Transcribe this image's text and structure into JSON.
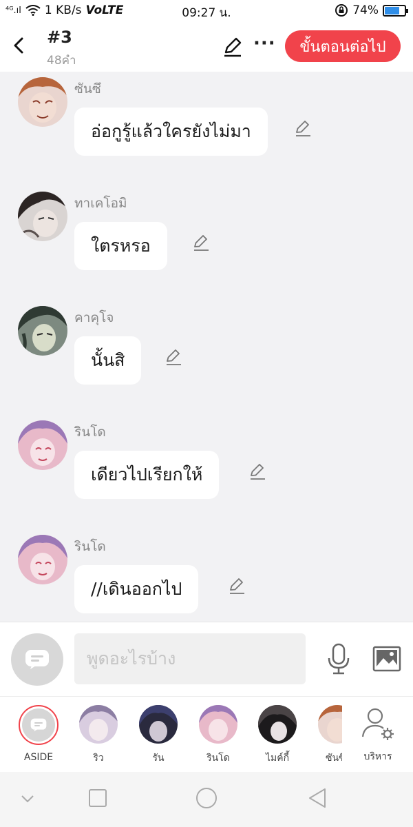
{
  "status_bar": {
    "signal": "⁴ᴳ.ıl",
    "speed": "1 KB/s",
    "network": "VoLTE",
    "time": "09:27 น.",
    "battery": "74%",
    "battery_level": 0.74,
    "battery_color": "#2f8ee8"
  },
  "header": {
    "title": "#3",
    "subtitle": "48คำ",
    "more_label": "···",
    "next_button": "ขั้นตอนต่อไป",
    "accent": "#f1434b"
  },
  "messages": [
    {
      "speaker": "ซันซึ",
      "text": "อ่อกูรู้แล้วใครยังไม่มา"
    },
    {
      "speaker": "ทาเคโอมิ",
      "text": "ใตรหรอ"
    },
    {
      "speaker": "คาคุโจ",
      "text": "นั้นสิ"
    },
    {
      "speaker": "รินโด",
      "text": "เดียวไปเรียกให้"
    },
    {
      "speaker": "รินโด",
      "text": "//เดินออกไป"
    }
  ],
  "composer": {
    "placeholder": "พูดอะไรบ้าง"
  },
  "characters": [
    {
      "name": "ASIDE"
    },
    {
      "name": "ริว"
    },
    {
      "name": "รัน"
    },
    {
      "name": "รินโด"
    },
    {
      "name": "ไมค์กี้"
    },
    {
      "name": "ซันซึ"
    },
    {
      "name": "บริหาร"
    }
  ],
  "icons": {
    "back": "chevron-left-icon",
    "edit": "pencil-icon",
    "mic": "microphone-icon",
    "image": "image-icon",
    "settings": "user-settings-icon"
  }
}
